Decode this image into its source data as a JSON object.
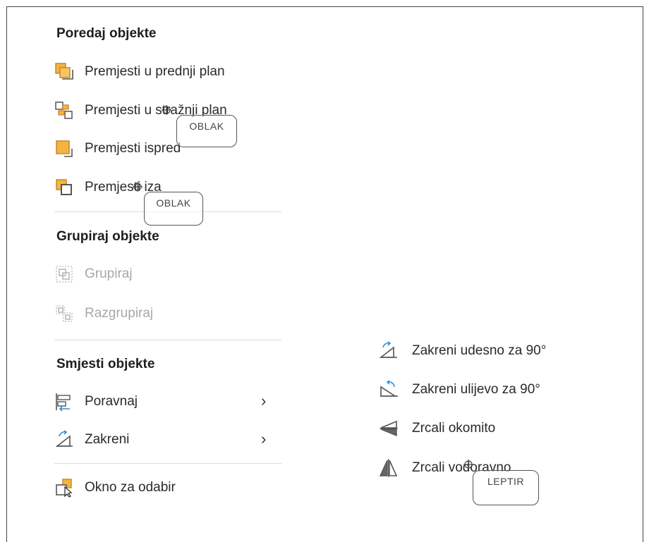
{
  "sections": {
    "arrange_title": "Poredaj objekte",
    "group_title": "Grupiraj objekte",
    "position_title": "Smjesti objekte"
  },
  "arrange_items": [
    {
      "label": "Premjesti u prednji plan",
      "icon": "bring-to-front-icon"
    },
    {
      "label": "Premjesti u stražnji plan",
      "icon": "send-to-back-icon"
    },
    {
      "label": "Premjesti ispred",
      "icon": "bring-forward-icon"
    },
    {
      "label": "Premjesti iza",
      "icon": "send-backward-icon"
    }
  ],
  "group_items": [
    {
      "label": "Grupiraj",
      "icon": "group-icon",
      "disabled": true
    },
    {
      "label": "Razgrupiraj",
      "icon": "ungroup-icon",
      "disabled": true
    }
  ],
  "position_items": [
    {
      "label": "Poravnaj",
      "icon": "align-icon",
      "chevron": "›"
    },
    {
      "label": "Zakreni",
      "icon": "rotate-icon",
      "chevron": "›"
    },
    {
      "label": "Okno za odabir",
      "icon": "selection-pane-icon"
    }
  ],
  "rotate_submenu": [
    {
      "label": "Zakreni udesno za 90°",
      "icon": "rotate-right-icon"
    },
    {
      "label": "Zakreni ulijevo za 90°",
      "icon": "rotate-left-icon"
    },
    {
      "label": "Zrcali okomito",
      "icon": "flip-vertical-icon"
    },
    {
      "label": "Zrcali vodoravno",
      "icon": "flip-horizontal-icon"
    }
  ],
  "annotations": [
    "OBLAK",
    "OBLAK",
    "LEPTIR"
  ],
  "colors": {
    "accent_orange": "#f3b540",
    "icon_gray": "#555555",
    "rotate_blue": "#2f8fd8"
  }
}
